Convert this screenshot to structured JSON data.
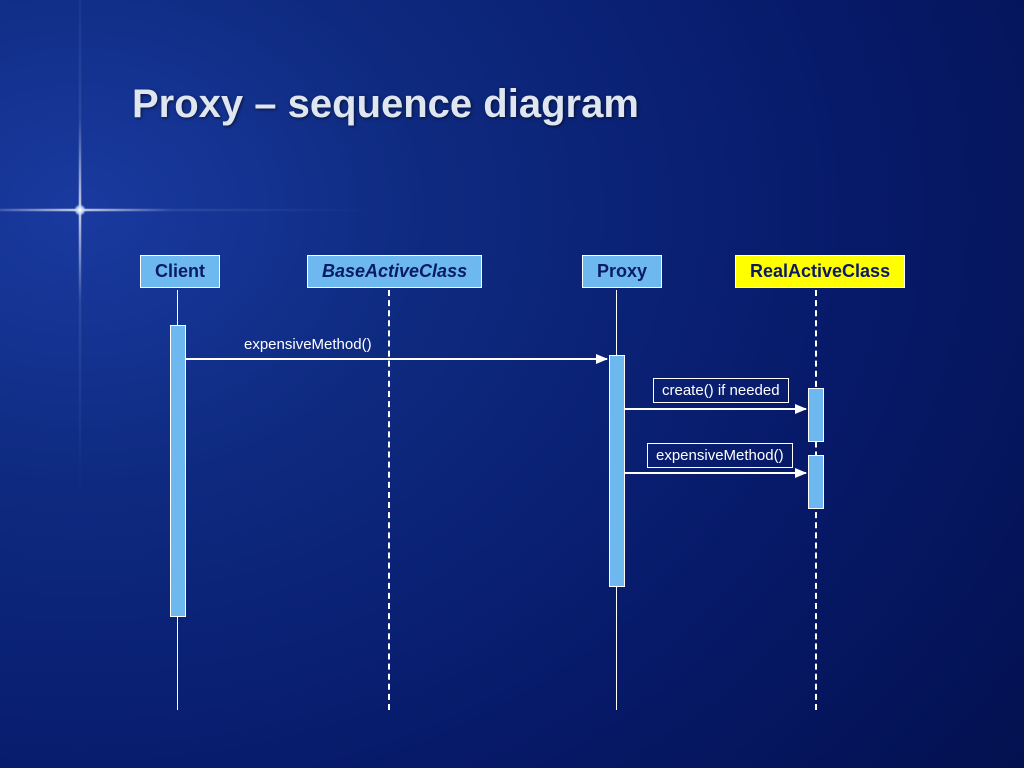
{
  "title": "Proxy – sequence diagram",
  "participants": {
    "client": "Client",
    "base": "BaseActiveClass",
    "proxy": "Proxy",
    "real": "RealActiveClass"
  },
  "messages": {
    "m1": "expensiveMethod()",
    "m2": "create() if needed",
    "m3": "expensiveMethod()"
  },
  "chart_data": {
    "type": "sequence-diagram",
    "participants": [
      {
        "id": "client",
        "label": "Client",
        "style": "blue",
        "lifeline": "solid"
      },
      {
        "id": "base",
        "label": "BaseActiveClass",
        "style": "blue",
        "lifeline": "dashed",
        "italic": true
      },
      {
        "id": "proxy",
        "label": "Proxy",
        "style": "blue",
        "lifeline": "solid"
      },
      {
        "id": "real",
        "label": "RealActiveClass",
        "style": "yellow",
        "lifeline": "dashed"
      }
    ],
    "messages": [
      {
        "from": "client",
        "to": "proxy",
        "label": "expensiveMethod()",
        "boxed": false
      },
      {
        "from": "proxy",
        "to": "real",
        "label": "create() if needed",
        "boxed": true
      },
      {
        "from": "proxy",
        "to": "real",
        "label": "expensiveMethod()",
        "boxed": true
      }
    ],
    "activations": [
      {
        "on": "client",
        "start": 1,
        "length": "long"
      },
      {
        "on": "proxy",
        "start": 1,
        "length": "medium"
      },
      {
        "on": "real",
        "start": 2,
        "length": "short"
      },
      {
        "on": "real",
        "start": 3,
        "length": "short"
      }
    ]
  }
}
